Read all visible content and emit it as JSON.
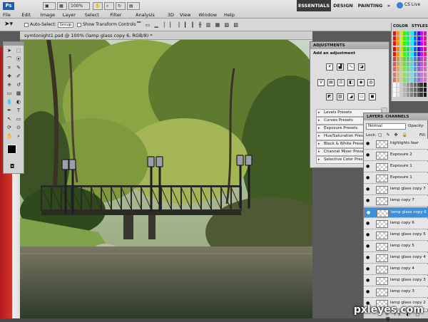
{
  "app": {
    "logo": "Ps",
    "zoom": "100%",
    "cs_live": "CS Live"
  },
  "menu": [
    "File",
    "Edit",
    "Image",
    "Layer",
    "Select",
    "Filter",
    "Analysis",
    "3D",
    "View",
    "Window",
    "Help"
  ],
  "workspaces": {
    "essentials": "ESSENTIALS",
    "design": "DESIGN",
    "painting": "PAINTING",
    "more": "»"
  },
  "options": {
    "auto_select": "Auto-Select:",
    "auto_select_value": "Group",
    "show_transform": "Show Transform Controls"
  },
  "document": {
    "tab_title": "symtonight1.psd @ 100% (lamp glass copy 6, RGB/8) *"
  },
  "adjustments": {
    "panel_title": "ADJUSTMENTS",
    "add_label": "Add an adjustment",
    "presets": [
      "Levels Presets",
      "Curves Presets",
      "Exposure Presets",
      "Hue/Saturation Presets",
      "Black & White Presets",
      "Channel Mixer Presets",
      "Selective Color Presets"
    ]
  },
  "color_panel": {
    "tabs": [
      "COLOR",
      "STYLES"
    ]
  },
  "layers": {
    "tabs": [
      "LAYERS",
      "CHANNELS"
    ],
    "blend_mode": "Normal",
    "opacity_label": "Opacity:",
    "lock_label": "Lock:",
    "fill_label": "Fill:",
    "rows": [
      {
        "name": "highlights fear",
        "selected": false
      },
      {
        "name": "Exposure 2",
        "selected": false
      },
      {
        "name": "Exposure 1",
        "selected": false
      },
      {
        "name": "Exposure 1",
        "selected": false
      },
      {
        "name": "lamp glass copy 7",
        "selected": false
      },
      {
        "name": "lamp copy 7",
        "selected": false
      },
      {
        "name": "lamp glass copy 6",
        "selected": true
      },
      {
        "name": "lamp copy 6",
        "selected": false
      },
      {
        "name": "lamp glass copy 5",
        "selected": false
      },
      {
        "name": "lamp copy 5",
        "selected": false
      },
      {
        "name": "lamp glass copy 4",
        "selected": false
      },
      {
        "name": "lamp copy 4",
        "selected": false
      },
      {
        "name": "lamp glass copy 3",
        "selected": false
      },
      {
        "name": "lamp copy 3",
        "selected": false
      },
      {
        "name": "lamp glass copy 2",
        "selected": false
      }
    ]
  },
  "watermark": "pxleyes.com"
}
